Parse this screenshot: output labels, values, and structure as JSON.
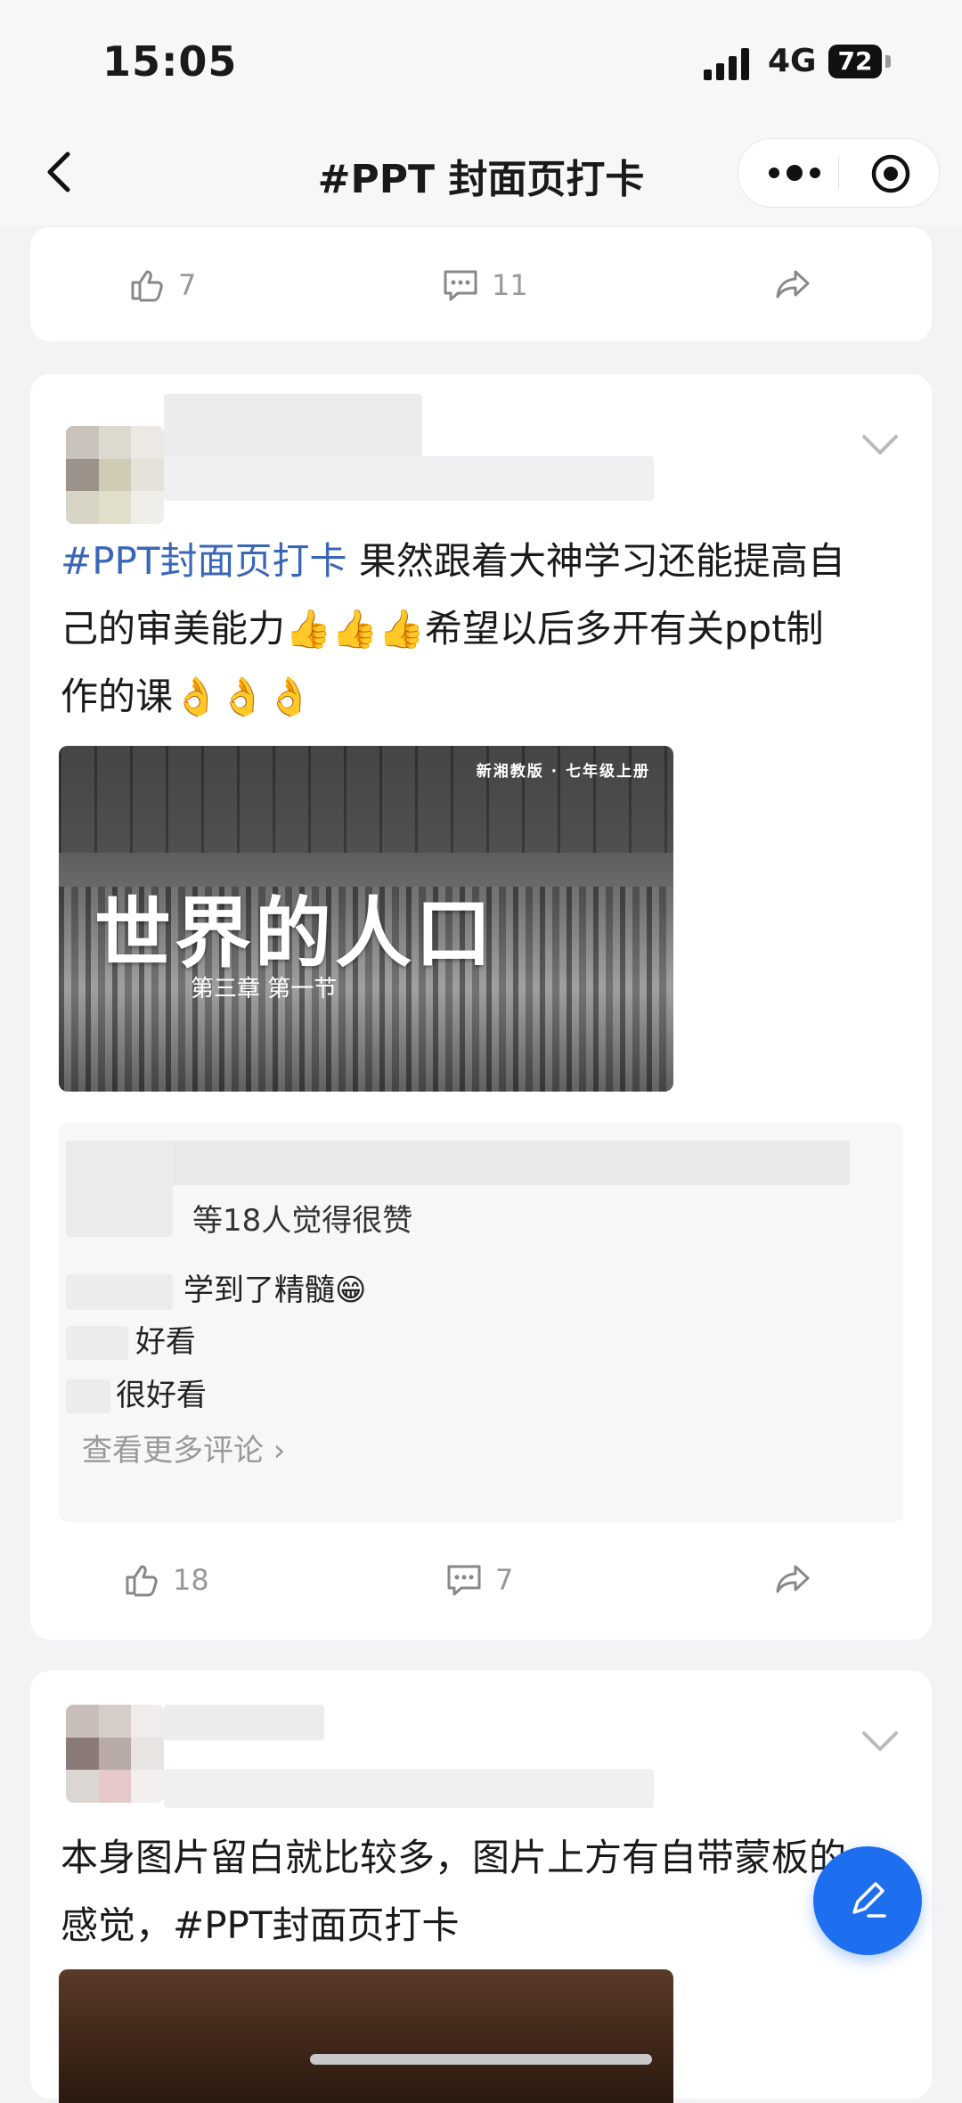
{
  "status_bar": {
    "time": "15:05",
    "network": "4G",
    "battery": "72"
  },
  "nav": {
    "title": "#PPT 封面页打卡"
  },
  "post_prev": {
    "likes": "7",
    "comments": "11"
  },
  "post_main": {
    "hashtag": "#PPT封面页打卡",
    "text_line1": " 果然跟着大神学习还能提高自",
    "text_line2": "己的审美能力👍👍👍希望以后多开有关ppt制",
    "text_line3": "作的课👌👌👌",
    "image": {
      "publisher": "新湘教版 · 七年级上册",
      "title": "世界的人口",
      "subtitle": "第三章  第一节"
    },
    "likes_summary": "等18人觉得很赞",
    "comments": [
      {
        "text": "学到了精髓😁"
      },
      {
        "text": "好看"
      },
      {
        "text": "很好看"
      }
    ],
    "more_comments": "查看更多评论 ›",
    "likes": "18",
    "comment_count": "7"
  },
  "post_third": {
    "text_line1": "本身图片留白就比较多，图片上方有自带蒙板的",
    "text_line2_prefix": "感觉，",
    "hashtag": "#PPT封面页打卡"
  },
  "colors": {
    "accent": "#1e6ff0",
    "hashtag": "#3a66b8",
    "background": "#f3f3f5"
  }
}
